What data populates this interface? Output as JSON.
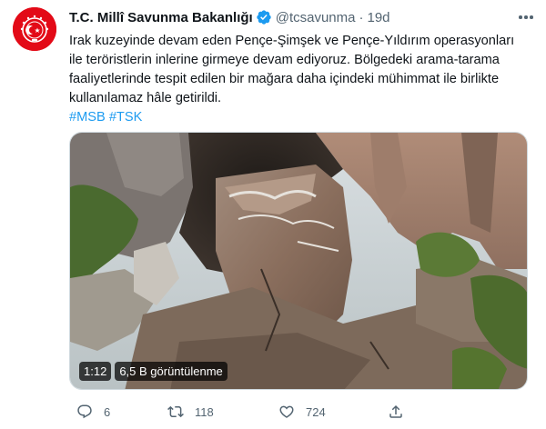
{
  "author": {
    "name": "T.C. Millî Savunma Bakanlığı",
    "handle": "@tcsavunma",
    "separator": "·",
    "time": "19d",
    "verified": true
  },
  "tweet": {
    "lines": [
      "Irak kuzeyinde devam eden Pençe-Şimşek ve Pençe-Yıldırım operasyonları",
      "ile teröristlerin inlerine girmeye devam ediyoruz. Bölgedeki arama-tarama",
      "faaliyetlerinde tespit edilen bir mağara daha içindeki mühimmat ile birlikte",
      "kullanılamaz hâle getirildi."
    ],
    "hashtags": [
      "#MSB",
      "#TSK"
    ]
  },
  "video": {
    "duration": "1:12",
    "views": "6,5 B görüntülenme"
  },
  "actions": {
    "reply_count": "6",
    "retweet_count": "118",
    "like_count": "724"
  },
  "colors": {
    "accent": "#1d9bf0",
    "text": "#0f1419",
    "muted": "#536471",
    "avatar_bg": "#e30a17"
  },
  "icons": [
    "verified-badge-icon",
    "more-icon",
    "reply-icon",
    "retweet-icon",
    "like-icon",
    "share-icon"
  ]
}
